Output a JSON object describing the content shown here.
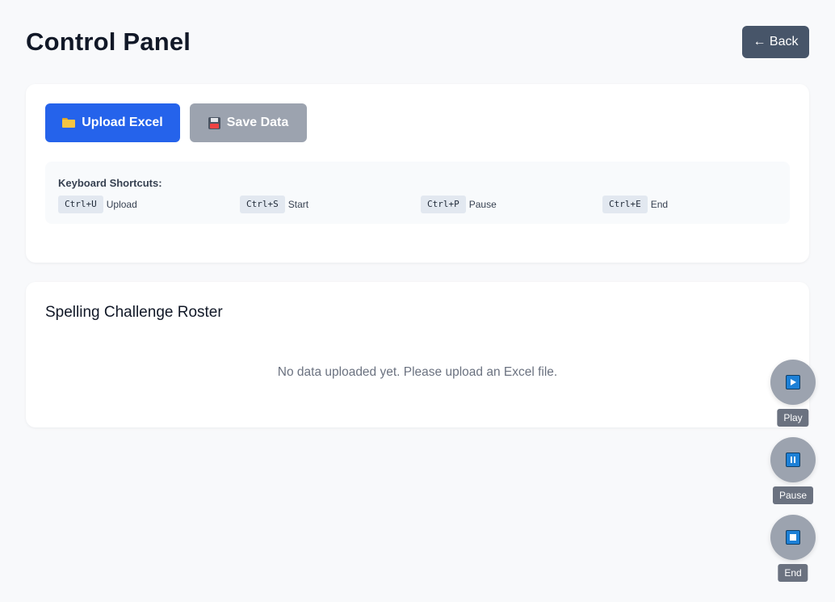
{
  "header": {
    "title": "Control Panel",
    "back_label": "← Back"
  },
  "toolbar": {
    "upload_label": "Upload Excel",
    "save_label": "Save Data"
  },
  "shortcuts": {
    "title": "Keyboard Shortcuts:",
    "items": [
      {
        "key": "Ctrl+U",
        "action": "Upload"
      },
      {
        "key": "Ctrl+S",
        "action": "Start"
      },
      {
        "key": "Ctrl+P",
        "action": "Pause"
      },
      {
        "key": "Ctrl+E",
        "action": "End"
      }
    ]
  },
  "roster": {
    "title": "Spelling Challenge Roster",
    "empty_message": "No data uploaded yet. Please upload an Excel file."
  },
  "controls": {
    "play_label": "Play",
    "pause_label": "Pause",
    "end_label": "End"
  },
  "colors": {
    "primary": "#2563eb",
    "disabled": "#9ca3af",
    "back_button": "#475569",
    "control_icon": "#1d80d6"
  }
}
